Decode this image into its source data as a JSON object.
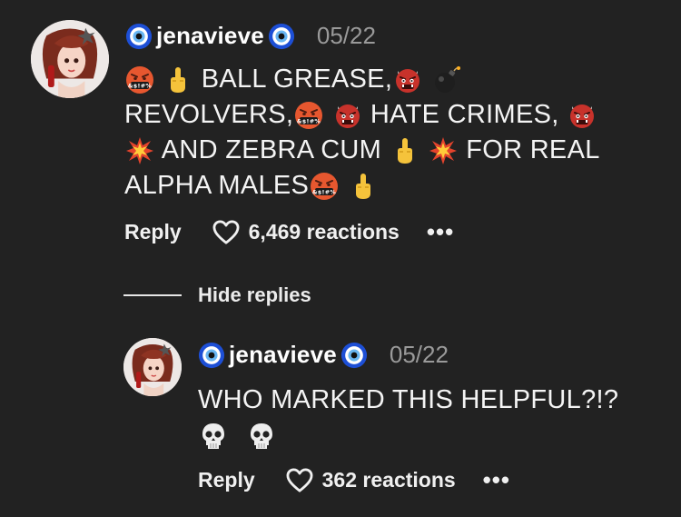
{
  "comment": {
    "username": "jenavieve",
    "date": "05/22",
    "lines": [
      [
        "BALL GREASE,"
      ],
      [
        "REVOLVERS,",
        "HATE CRIMES,"
      ],
      [
        "AND ZEBRA CUM",
        "FOR REAL"
      ],
      [
        "ALPHA MALES"
      ]
    ],
    "reply_label": "Reply",
    "reactions_label": "6,469 reactions",
    "more_label": "•••"
  },
  "thread": {
    "hide_replies_label": "Hide replies"
  },
  "reply": {
    "username": "jenavieve",
    "date": "05/22",
    "text": "WHO MARKED THIS HELPFUL?!?",
    "reply_label": "Reply",
    "reactions_label": "362 reactions",
    "more_label": "•••"
  },
  "icons": {
    "eye": "nazar-amulet-icon",
    "angry": "face-with-symbols-icon",
    "finger": "middle-finger-icon",
    "ogre": "ogre-icon",
    "bomb": "bomb-icon",
    "collision": "collision-icon",
    "skull": "skull-icon",
    "heart": "heart-outline-icon"
  },
  "colors": {
    "background": "#222222",
    "date": "#9a9a9a"
  }
}
